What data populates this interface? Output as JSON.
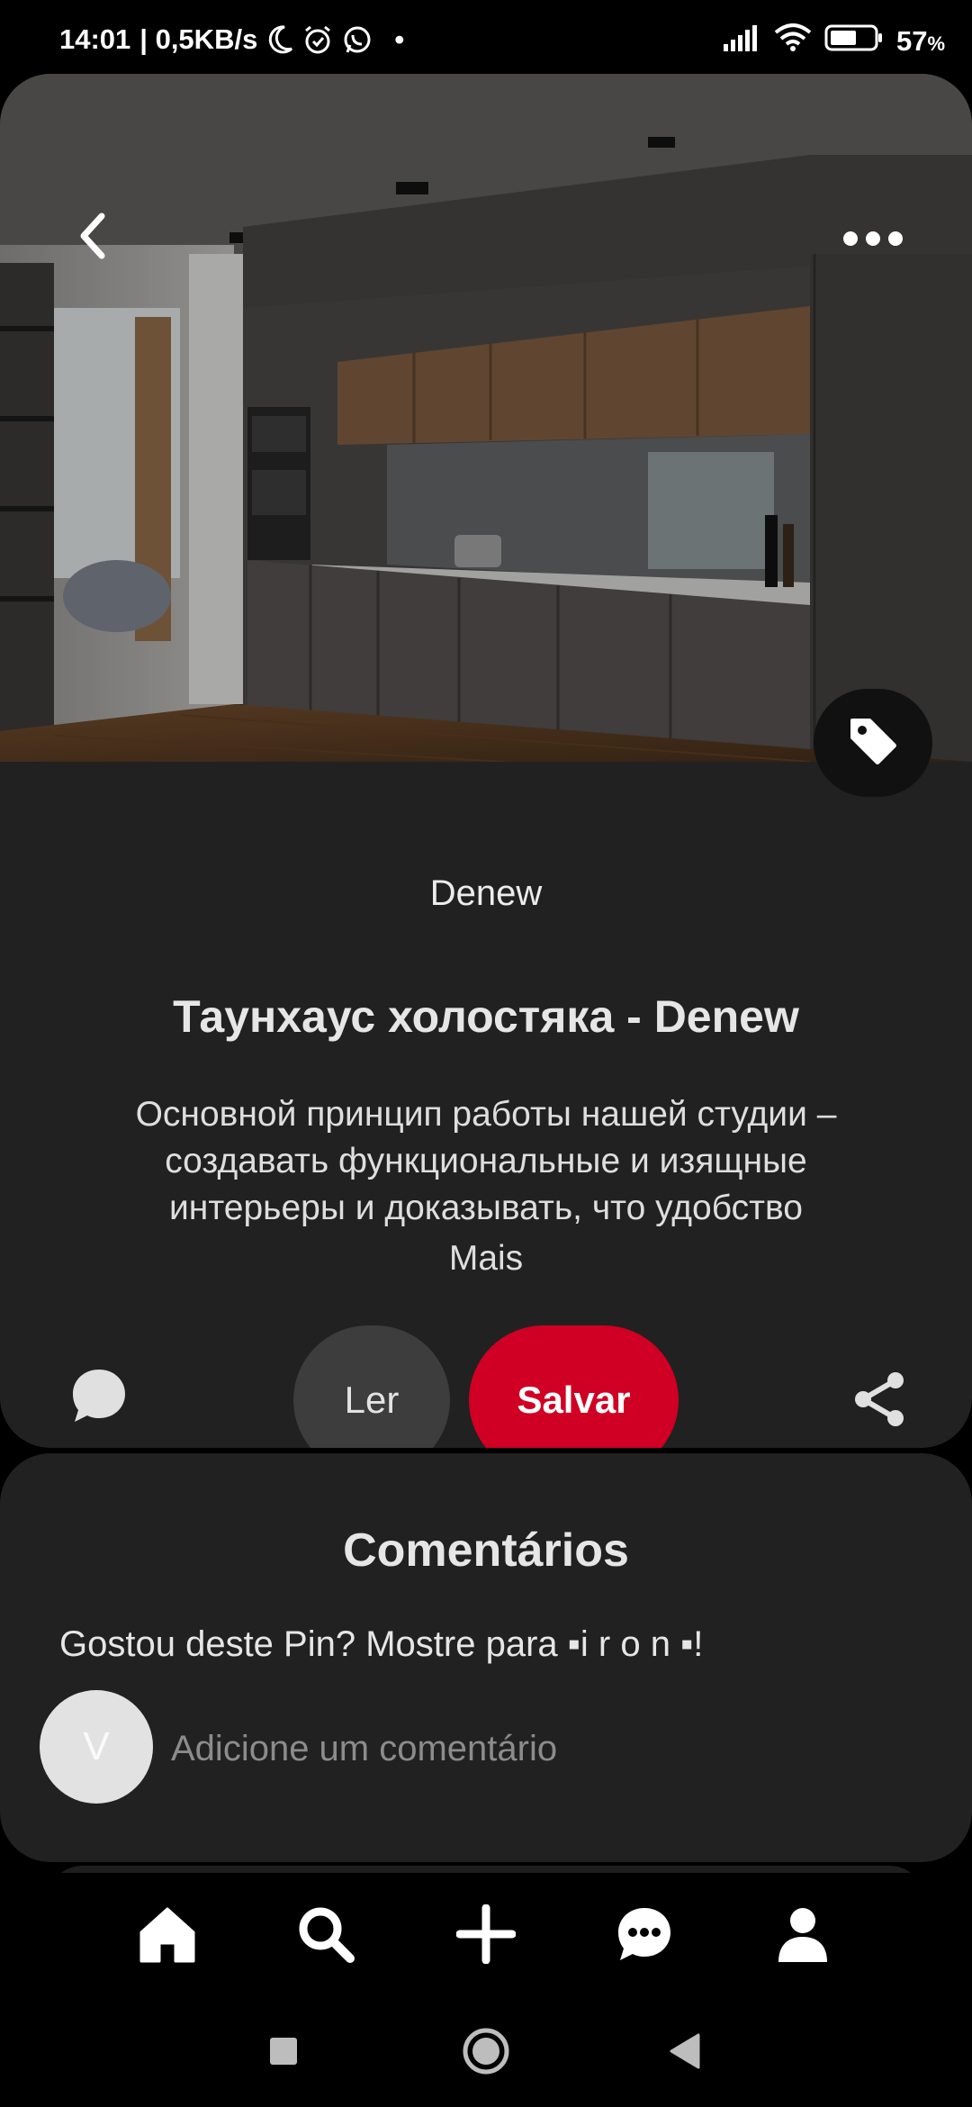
{
  "status_bar": {
    "time": "14:01",
    "net_speed": "| 0,5KB/s",
    "dot": "•",
    "battery": "57",
    "battery_unit": "%",
    "icons_left": [
      "moon-icon",
      "alarm-icon",
      "whatsapp-icon"
    ],
    "icons_right": [
      "signal-icon",
      "wifi-icon",
      "battery-icon"
    ]
  },
  "pin": {
    "source": "Denew",
    "title": "Таунхаус холостяка - Denew",
    "description": "Основной принцип работы нашей студии – создавать функциональные и изящные интерьеры и доказывать, что удобство",
    "more_label": "Mais",
    "read_label": "Ler",
    "save_label": "Salvar",
    "icons": [
      "back-icon",
      "more-icon",
      "tag-icon",
      "comment-icon",
      "share-icon"
    ]
  },
  "comments": {
    "heading": "Comentários",
    "prompt": "Gostou deste Pin? Mostre para ▪i r o n ▪!",
    "avatar_initial": "V",
    "input_placeholder": "Adicione um comentário"
  },
  "bottom_nav": {
    "items": [
      "home-icon",
      "search-icon",
      "plus-icon",
      "messages-icon",
      "profile-icon"
    ]
  },
  "system_nav": {
    "items": [
      "recents-icon",
      "home-circle-icon",
      "back-triangle-icon"
    ]
  },
  "colors": {
    "background": "#000000",
    "card": "#212121",
    "save_button": "#cf0023",
    "read_button": "#3d3d3d"
  }
}
